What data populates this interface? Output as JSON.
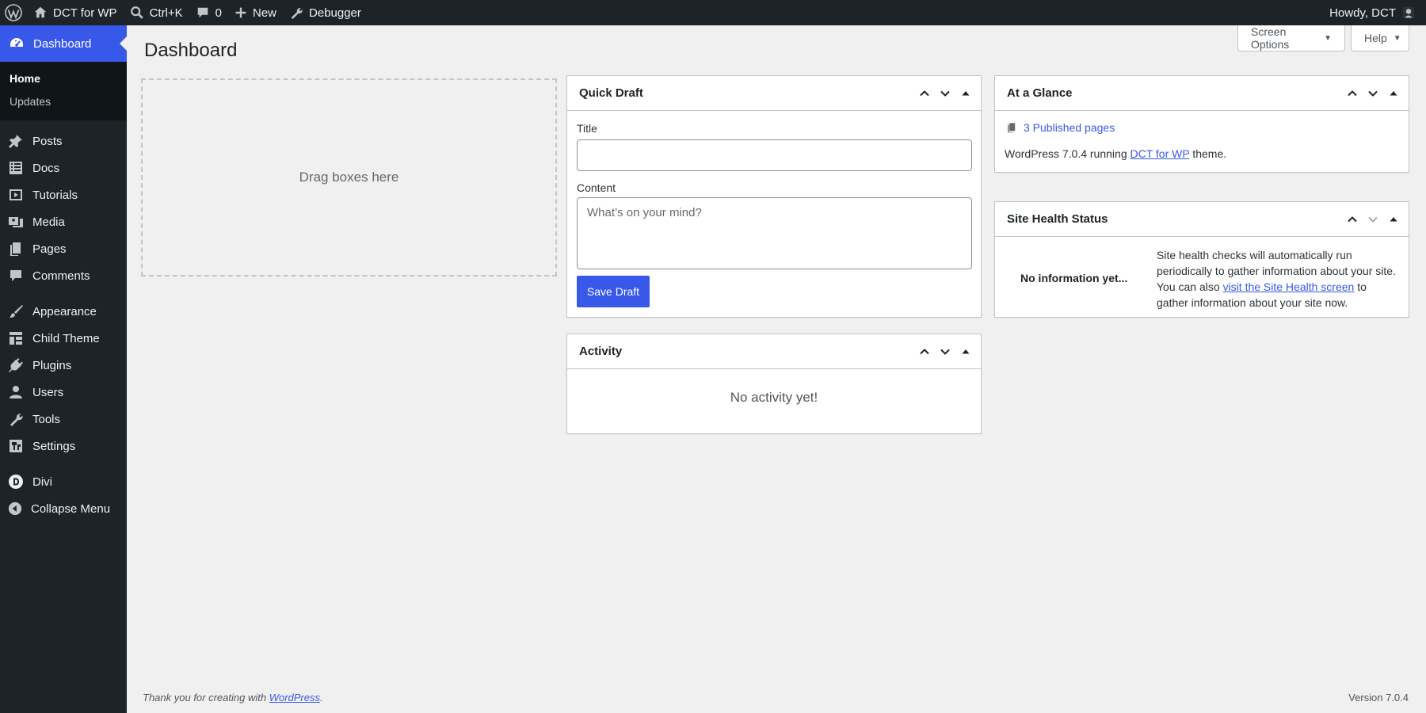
{
  "colors": {
    "admin_bar_bg": "#1d2327",
    "accent": "#3858e9",
    "body_bg": "#f0f0f1"
  },
  "admin_bar": {
    "wp_logo_icon": "wordpress-logo-icon",
    "site_name": "DCT for WP",
    "search_shortcut": "Ctrl+K",
    "comments_count": "0",
    "new_label": "New",
    "debugger_label": "Debugger",
    "greeting": "Howdy, DCT"
  },
  "sidebar": {
    "current": {
      "label": "Dashboard",
      "icon": "dashboard-icon"
    },
    "submenu": [
      {
        "label": "Home"
      },
      {
        "label": "Updates"
      }
    ],
    "items": [
      {
        "label": "Posts",
        "icon": "pin-icon"
      },
      {
        "label": "Docs",
        "icon": "list-icon"
      },
      {
        "label": "Tutorials",
        "icon": "video-icon"
      },
      {
        "label": "Media",
        "icon": "media-icon"
      },
      {
        "label": "Pages",
        "icon": "page-icon"
      },
      {
        "label": "Comments",
        "icon": "comment-icon"
      },
      {
        "label": "Appearance",
        "icon": "brush-icon"
      },
      {
        "label": "Child Theme",
        "icon": "grid-icon"
      },
      {
        "label": "Plugins",
        "icon": "plug-icon"
      },
      {
        "label": "Users",
        "icon": "user-icon"
      },
      {
        "label": "Tools",
        "icon": "wrench-icon"
      },
      {
        "label": "Settings",
        "icon": "sliders-icon"
      },
      {
        "label": "Divi",
        "icon": "divi-icon"
      },
      {
        "label": "Collapse Menu",
        "icon": "collapse-icon"
      }
    ]
  },
  "header": {
    "title": "Dashboard",
    "screen_options": "Screen Options",
    "help": "Help"
  },
  "dropzone": {
    "text": "Drag boxes here"
  },
  "quick_draft": {
    "title": "Quick Draft",
    "title_label": "Title",
    "title_value": "",
    "content_label": "Content",
    "content_placeholder": "What’s on your mind?",
    "save_label": "Save Draft"
  },
  "activity": {
    "title": "Activity",
    "empty_text": "No activity yet!"
  },
  "at_a_glance": {
    "title": "At a Glance",
    "pages_link": "3 Published pages",
    "running_prefix": "WordPress 7.0.4 running ",
    "theme_link": "DCT for WP",
    "running_suffix": " theme."
  },
  "site_health": {
    "title": "Site Health Status",
    "no_info": "No information yet...",
    "text_before": "Site health checks will automatically run periodically to gather information about your site. You can also ",
    "link": "visit the Site Health screen",
    "text_after": " to gather information about your site now."
  },
  "footer": {
    "thanks_prefix": "Thank you for creating with ",
    "thanks_link": "WordPress",
    "thanks_suffix": ".",
    "version": "Version 7.0.4"
  }
}
